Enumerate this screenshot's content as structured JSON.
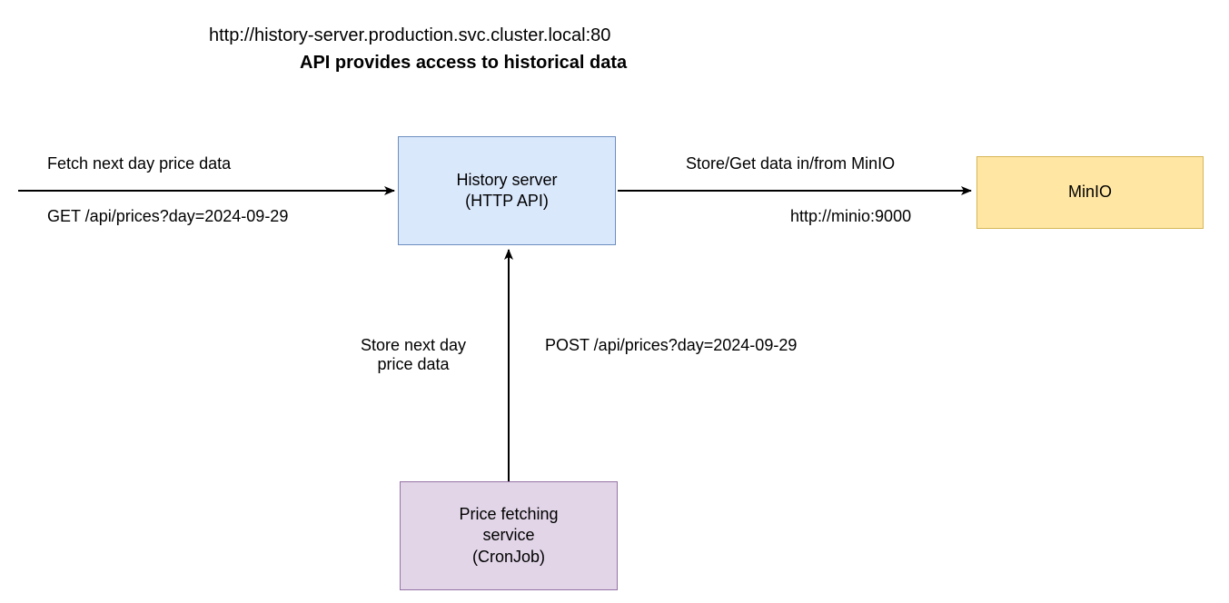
{
  "header": {
    "url": "http://history-server.production.svc.cluster.local:80",
    "subtitle": "API provides access to historical data"
  },
  "nodes": {
    "history_server": {
      "line1": "History server",
      "line2": "(HTTP API)"
    },
    "price_service": {
      "line1": "Price fetching",
      "line2": "service",
      "line3": "(CronJob)"
    },
    "minio": {
      "label": "MinIO"
    }
  },
  "edges": {
    "left": {
      "top_label": "Fetch next day price data",
      "bottom_label": "GET /api/prices?day=2024-09-29"
    },
    "right": {
      "top_label": "Store/Get data in/from MinIO",
      "bottom_label": "http://minio:9000"
    },
    "bottom": {
      "left_label_line1": "Store next day",
      "left_label_line2": "price data",
      "right_label": "POST /api/prices?day=2024-09-29"
    }
  },
  "colors": {
    "history_fill": "#dae8fc",
    "history_stroke": "#6c8ebf",
    "price_fill": "#e1d5e7",
    "price_stroke": "#9673a6",
    "minio_fill": "#ffe6a3",
    "minio_stroke": "#d6b656"
  }
}
